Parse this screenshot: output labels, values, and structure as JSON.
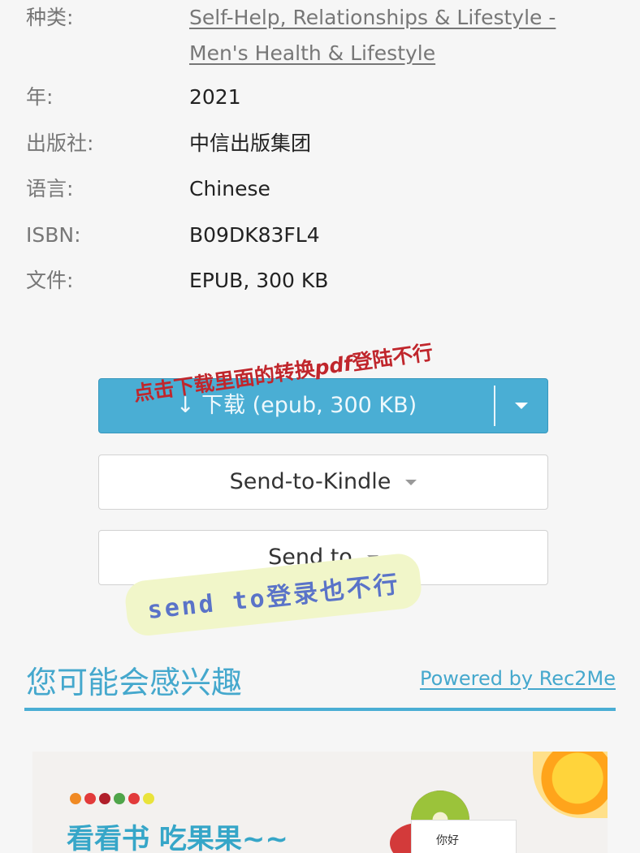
{
  "details": [
    {
      "key": "种类:",
      "value_lines": [
        "Self-Help, Relationships & Lifestyle -",
        "Men's Health & Lifestyle"
      ],
      "is_link": true
    },
    {
      "key": "年:",
      "value": "2021"
    },
    {
      "key": "出版社:",
      "value": "中信出版集团"
    },
    {
      "key": "语言:",
      "value": "Chinese"
    },
    {
      "key": "ISBN:",
      "value": "B09DK83FL4"
    },
    {
      "key": "文件:",
      "value": "EPUB, 300 KB"
    }
  ],
  "download": {
    "label": "↓ 下载 (epub, 300 KB)",
    "dropdown_icon": "caret-down-icon"
  },
  "annotation_top": {
    "text_before": "点击下载里面的转换",
    "text_pdf": "pdf",
    "text_after": "登陆不行"
  },
  "send_to_kindle": {
    "label": "Send-to-Kindle",
    "icon": "caret-down-icon"
  },
  "send_to": {
    "label": "Send to",
    "icon": "caret-down-icon"
  },
  "annotation_sticker": {
    "text": "send to登录也不行"
  },
  "recommendations": {
    "title": "您可能会感兴趣",
    "powered_by": "Powered by Rec2Me"
  },
  "banner": {
    "title": "看看书 吃果果~~",
    "card_text": "你好"
  },
  "colors": {
    "accent": "#4aaed4",
    "annotation_red": "#c0262c",
    "sticker_bg": "#f1f6c9",
    "sticker_text": "#5a73c8"
  }
}
